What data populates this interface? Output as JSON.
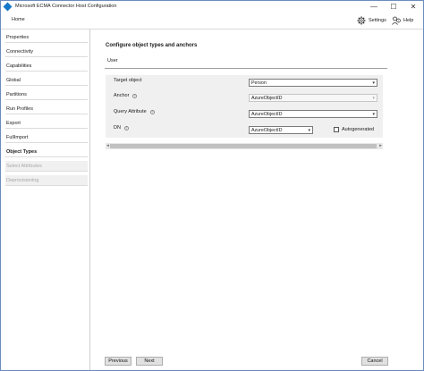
{
  "window": {
    "title": "Microsoft ECMA Connector Host Configuration",
    "controls": {
      "minimize": "—",
      "maximize": "☐",
      "close": "✕"
    }
  },
  "topbar": {
    "home_label": "Home",
    "settings_label": "Settings",
    "help_label": "Help"
  },
  "sidebar": {
    "items": [
      {
        "label": "Properties",
        "state": "normal"
      },
      {
        "label": "Connectivity",
        "state": "normal"
      },
      {
        "label": "Capabilities",
        "state": "normal"
      },
      {
        "label": "Global",
        "state": "normal"
      },
      {
        "label": "Partitions",
        "state": "normal"
      },
      {
        "label": "Run Profiles",
        "state": "normal"
      },
      {
        "label": "Export",
        "state": "normal"
      },
      {
        "label": "FullImport",
        "state": "normal"
      },
      {
        "label": "Object Types",
        "state": "active"
      },
      {
        "label": "Select Attributes",
        "state": "disabled"
      },
      {
        "label": "Deprovisioning",
        "state": "disabled"
      }
    ]
  },
  "main": {
    "title": "Configure object types and anchors",
    "tab_label": "User",
    "fields": {
      "target_object": {
        "label": "Target object",
        "value": "Person"
      },
      "anchor": {
        "label": "Anchor",
        "value": "AzureObjectID"
      },
      "query_attribute": {
        "label": "Query Attribute",
        "value": "AzureObjectID"
      },
      "dn": {
        "label": "DN",
        "value": "AzureObjectID"
      }
    },
    "autogenerated_label": "Autogenerated",
    "autogenerated_checked": false
  },
  "footer": {
    "previous_label": "Previous",
    "next_label": "Next",
    "cancel_label": "Cancel"
  },
  "colors": {
    "accent": "#1677c9",
    "panel_bg": "#f0f0f0",
    "disabled_text": "#a8a8a8"
  }
}
